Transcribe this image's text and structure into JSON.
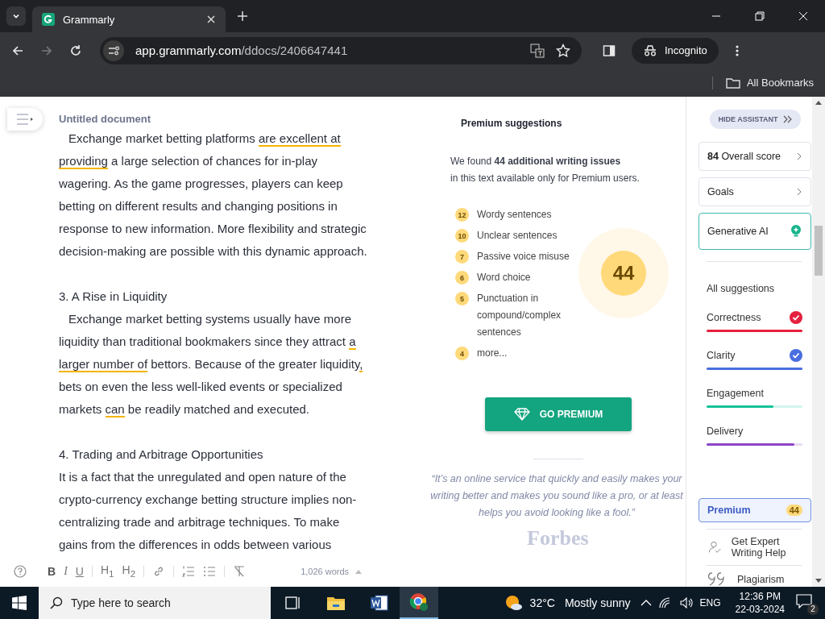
{
  "browser": {
    "tab_title": "Grammarly",
    "url_host": "app.grammarly.com",
    "url_path": "/ddocs/2406647441",
    "profile": "Incognito",
    "bookmarks": "All Bookmarks"
  },
  "document": {
    "title": "Untitled document",
    "lines": [
      {
        "kind": "text",
        "indent": true,
        "segments": [
          {
            "text": "Exchange market betting platforms ",
            "flagged": false
          },
          {
            "text": "are excellent at",
            "flagged": true
          }
        ]
      },
      {
        "kind": "text",
        "indent": false,
        "segments": [
          {
            "text": "providing",
            "flagged": true
          },
          {
            "text": " a large selection of chances for in-play",
            "flagged": false
          }
        ]
      },
      {
        "kind": "text",
        "indent": false,
        "segments": [
          {
            "text": "wagering. As the game progresses, players can keep",
            "flagged": false
          }
        ]
      },
      {
        "kind": "text",
        "indent": false,
        "segments": [
          {
            "text": "betting on different results and changing positions in",
            "flagged": false
          }
        ]
      },
      {
        "kind": "text",
        "indent": false,
        "segments": [
          {
            "text": "response to new information. More flexibility and strategic",
            "flagged": false
          }
        ]
      },
      {
        "kind": "text",
        "indent": false,
        "segments": [
          {
            "text": "decision-making are possible with this dynamic approach.",
            "flagged": false
          }
        ]
      },
      {
        "kind": "blank"
      },
      {
        "kind": "text",
        "indent": false,
        "segments": [
          {
            "text": "3. A Rise in Liquidity",
            "flagged": false
          }
        ]
      },
      {
        "kind": "text",
        "indent": true,
        "segments": [
          {
            "text": "Exchange market betting systems usually have more",
            "flagged": false
          }
        ]
      },
      {
        "kind": "text",
        "indent": false,
        "segments": [
          {
            "text": "liquidity than traditional bookmakers since they attract ",
            "flagged": false
          },
          {
            "text": "a",
            "flagged": true
          }
        ]
      },
      {
        "kind": "text",
        "indent": false,
        "segments": [
          {
            "text": "larger number of",
            "flagged": true
          },
          {
            "text": " bettors. Because of the greater liquidity",
            "flagged": false
          },
          {
            "text": ",",
            "flagged": true
          }
        ]
      },
      {
        "kind": "text",
        "indent": false,
        "segments": [
          {
            "text": "bets on even the less well-liked events or specialized",
            "flagged": false
          }
        ]
      },
      {
        "kind": "text",
        "indent": false,
        "segments": [
          {
            "text": "markets ",
            "flagged": false
          },
          {
            "text": "can",
            "flagged": true
          },
          {
            "text": " be readily matched and executed.",
            "flagged": false
          }
        ]
      },
      {
        "kind": "blank"
      },
      {
        "kind": "text",
        "indent": false,
        "segments": [
          {
            "text": "4. Trading and Arbitrage Opportunities",
            "flagged": false
          }
        ]
      },
      {
        "kind": "text",
        "indent": false,
        "segments": [
          {
            "text": "It is a fact that the unregulated and open nature of the",
            "flagged": false
          }
        ]
      },
      {
        "kind": "text",
        "indent": false,
        "segments": [
          {
            "text": "crypto-currency exchange betting structure implies non-",
            "flagged": false
          }
        ]
      },
      {
        "kind": "text",
        "indent": false,
        "segments": [
          {
            "text": "centralizing trade and arbitrage techniques. To make",
            "flagged": false
          }
        ]
      },
      {
        "kind": "text",
        "indent": false,
        "segments": [
          {
            "text": "gains from the differences in odds between various",
            "flagged": false
          }
        ]
      }
    ],
    "toolbar": [
      {
        "kind": "bold",
        "label": "B"
      },
      {
        "kind": "italic",
        "label": "I"
      },
      {
        "kind": "underline",
        "label": "U"
      },
      {
        "kind": "sep"
      },
      {
        "kind": "heading",
        "label": "H$_{1}$"
      },
      {
        "kind": "heading",
        "label": "H$_{2}$"
      },
      {
        "kind": "sep"
      },
      {
        "kind": "link"
      },
      {
        "kind": "sep"
      },
      {
        "kind": "numbered-list"
      },
      {
        "kind": "bullet-list"
      },
      {
        "kind": "sep"
      },
      {
        "kind": "clear-format"
      }
    ],
    "word_count": "1,026 words"
  },
  "premium": {
    "heading": "Premium suggestions",
    "intro": "We found **44 additional writing issues**",
    "intro_2": "in this text available only for Premium users.",
    "issues": [
      {
        "count": "12",
        "label": "Wordy sentences"
      },
      {
        "count": "10",
        "label": "Unclear sentences"
      },
      {
        "count": "7",
        "label": "Passive voice misuse"
      },
      {
        "count": "6",
        "label": "Word choice"
      },
      {
        "count": "5",
        "label": "Punctuation in compound/complex sentences"
      },
      {
        "count": "4",
        "label": "more..."
      }
    ],
    "total": "44",
    "button": "GO PREMIUM",
    "quote": "“It’s an online service that quickly and easily makes your writing better and makes you sound like a pro, or at least helps you avoid looking like a fool.”",
    "source": "Forbes"
  },
  "sidebar": {
    "hide_button": "HIDE ASSISTANT",
    "score": "84",
    "score_label": "Overall score",
    "goals": "Goals",
    "generative": "Generative AI",
    "all_suggestions": "All suggestions",
    "categories": [
      {
        "label": "Correctness",
        "color": "#e5213f",
        "level": 1,
        "checked": true
      },
      {
        "label": "Clarity",
        "color": "#4a6ee0",
        "level": 1,
        "checked": true
      },
      {
        "label": "Engagement",
        "color": "#15c39a",
        "level": 0.7,
        "checked": false
      },
      {
        "label": "Delivery",
        "color": "#8e44c9",
        "level": 0.92,
        "checked": false
      }
    ],
    "premium": "Premium",
    "premium_count": "44",
    "expert": "Get Expert Writing Help",
    "plagiarism": "Plagiarism"
  },
  "taskbar": {
    "search_placeholder": "Type here to search",
    "temperature": "32°C",
    "weather": "Mostly sunny",
    "language": "ENG",
    "time": "12:36 PM",
    "date": "22-03-2024",
    "notifications": "2"
  }
}
